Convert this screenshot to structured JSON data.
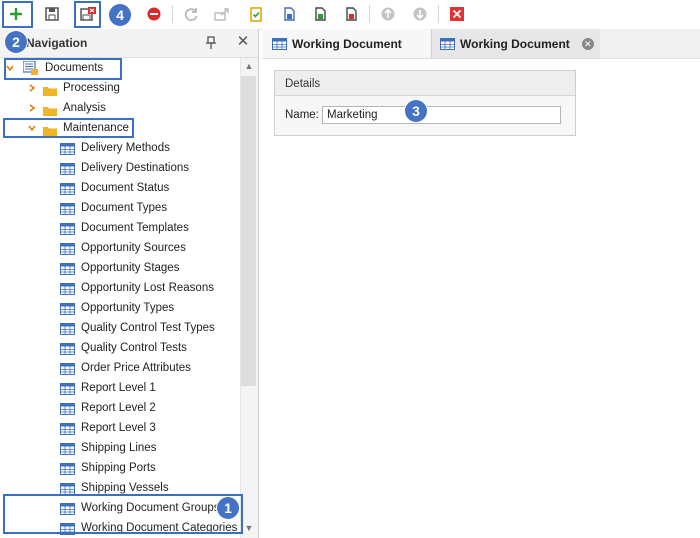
{
  "toolbar": {
    "icons": [
      "new-icon",
      "save-icon",
      "save-and-close-icon",
      "delete-icon",
      "refresh-icon",
      "export-icon",
      "validate-icon",
      "copy-icon",
      "copy-green-icon",
      "copy-red-icon",
      "move-up-icon",
      "move-down-icon",
      "close-red-icon"
    ]
  },
  "nav": {
    "title": "Navigation",
    "close_glyph": "✕",
    "tree": {
      "root": "Documents",
      "folders": [
        {
          "label": "Processing"
        },
        {
          "label": "Analysis"
        },
        {
          "label": "Maintenance"
        }
      ],
      "items": [
        "Delivery Methods",
        "Delivery Destinations",
        "Document Status",
        "Document Types",
        "Document Templates",
        "Opportunity Sources",
        "Opportunity Stages",
        "Opportunity Lost Reasons",
        "Opportunity Types",
        "Quality Control Test Types",
        "Quality Control Tests",
        "Order Price Attributes",
        "Report Level 1",
        "Report Level 2",
        "Report Level 3",
        "Shipping Lines",
        "Shipping Ports",
        "Shipping Vessels",
        "Working Document Groups",
        "Working Document Categories"
      ]
    }
  },
  "tabs": [
    {
      "label": "Working Document"
    },
    {
      "label": "Working Document",
      "close_glyph": "✕"
    }
  ],
  "details": {
    "title": "Details",
    "name_label": "Name:",
    "name_value": "Marketing"
  },
  "annotations": [
    "1",
    "2",
    "3",
    "4"
  ],
  "colors": {
    "accent": "#4472c4",
    "folder": "#f0b429",
    "grid_icon": "#3f6fb8",
    "delete_red": "#d92b2b",
    "add_green": "#2f9a3a"
  }
}
